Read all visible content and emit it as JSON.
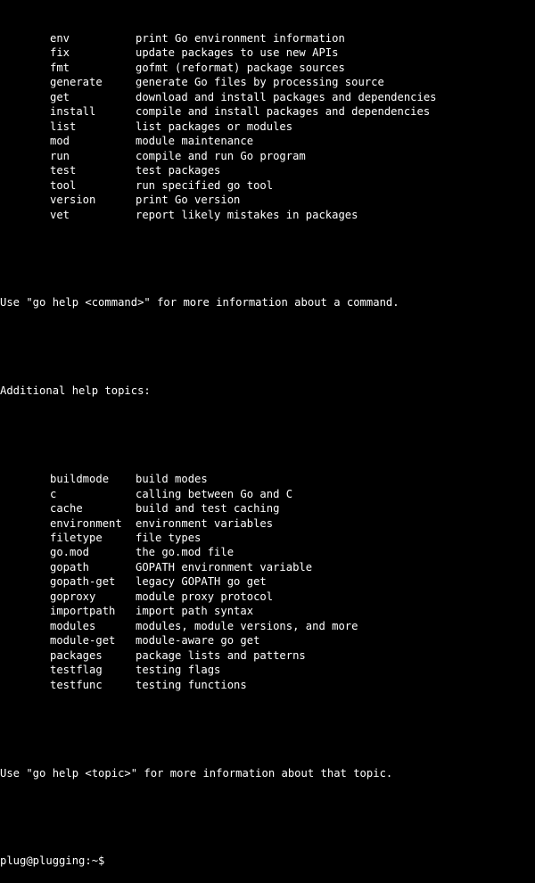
{
  "commands": [
    {
      "name": "env",
      "desc": "print Go environment information"
    },
    {
      "name": "fix",
      "desc": "update packages to use new APIs"
    },
    {
      "name": "fmt",
      "desc": "gofmt (reformat) package sources"
    },
    {
      "name": "generate",
      "desc": "generate Go files by processing source"
    },
    {
      "name": "get",
      "desc": "download and install packages and dependencies"
    },
    {
      "name": "install",
      "desc": "compile and install packages and dependencies"
    },
    {
      "name": "list",
      "desc": "list packages or modules"
    },
    {
      "name": "mod",
      "desc": "module maintenance"
    },
    {
      "name": "run",
      "desc": "compile and run Go program"
    },
    {
      "name": "test",
      "desc": "test packages"
    },
    {
      "name": "tool",
      "desc": "run specified go tool"
    },
    {
      "name": "version",
      "desc": "print Go version"
    },
    {
      "name": "vet",
      "desc": "report likely mistakes in packages"
    }
  ],
  "command_help_hint": "Use \"go help <command>\" for more information about a command.",
  "topics_header": "Additional help topics:",
  "topics": [
    {
      "name": "buildmode",
      "desc": "build modes"
    },
    {
      "name": "c",
      "desc": "calling between Go and C"
    },
    {
      "name": "cache",
      "desc": "build and test caching"
    },
    {
      "name": "environment",
      "desc": "environment variables"
    },
    {
      "name": "filetype",
      "desc": "file types"
    },
    {
      "name": "go.mod",
      "desc": "the go.mod file"
    },
    {
      "name": "gopath",
      "desc": "GOPATH environment variable"
    },
    {
      "name": "gopath-get",
      "desc": "legacy GOPATH go get"
    },
    {
      "name": "goproxy",
      "desc": "module proxy protocol"
    },
    {
      "name": "importpath",
      "desc": "import path syntax"
    },
    {
      "name": "modules",
      "desc": "modules, module versions, and more"
    },
    {
      "name": "module-get",
      "desc": "module-aware go get"
    },
    {
      "name": "packages",
      "desc": "package lists and patterns"
    },
    {
      "name": "testflag",
      "desc": "testing flags"
    },
    {
      "name": "testfunc",
      "desc": "testing functions"
    }
  ],
  "topic_help_hint": "Use \"go help <topic>\" for more information about that topic.",
  "prompt": "plug@plugging:~$ "
}
